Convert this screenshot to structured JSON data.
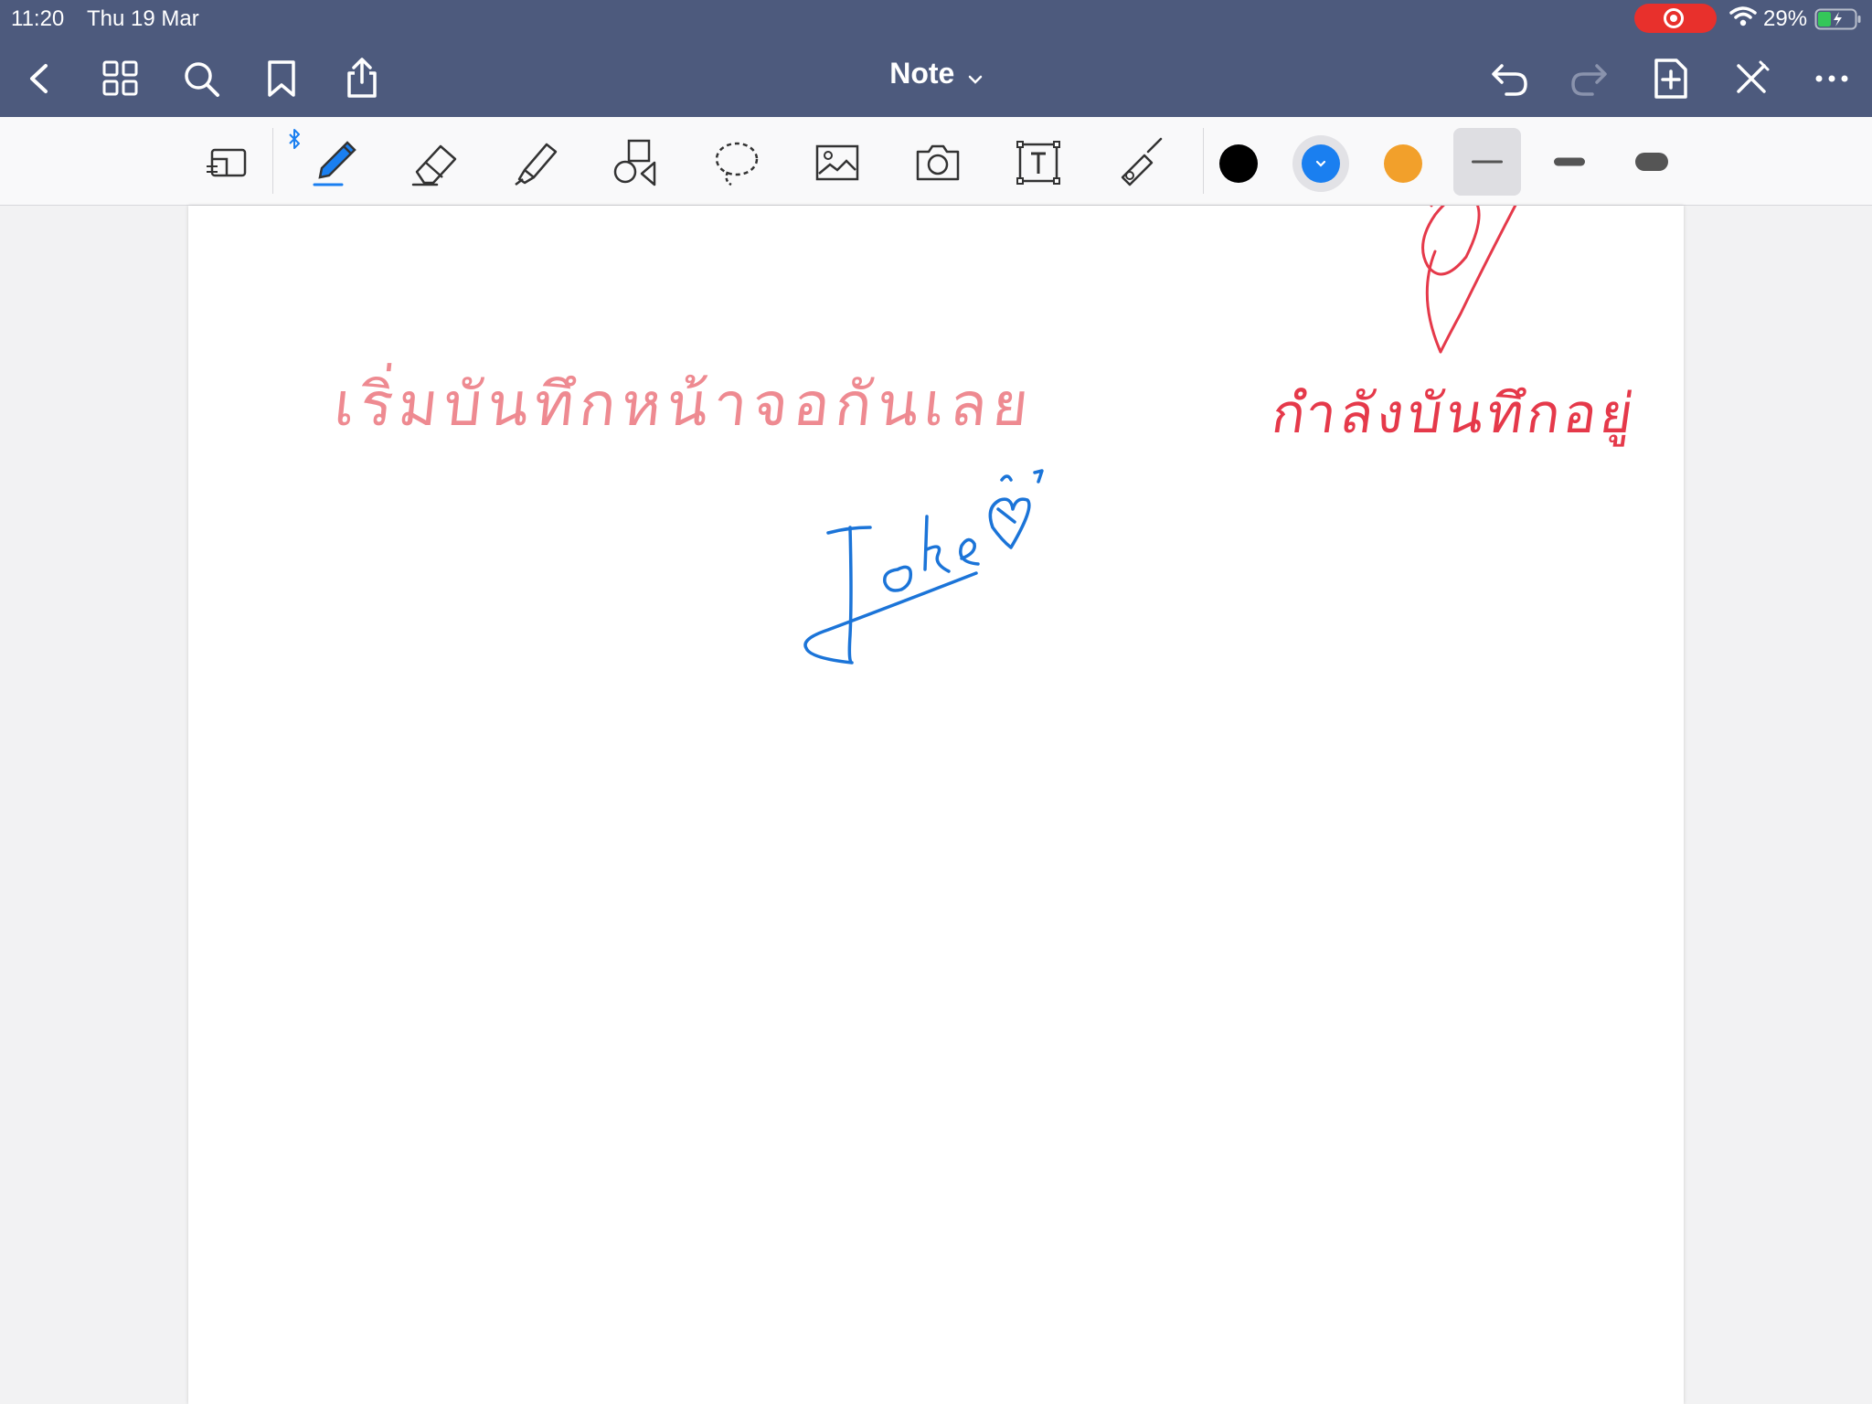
{
  "status_bar": {
    "time": "11:20",
    "date": "Thu 19 Mar",
    "battery_percent": "29%",
    "recording_color": "#e8302c"
  },
  "nav": {
    "title": "Note",
    "icons": [
      "back-chevron-icon",
      "grid-icon",
      "search-icon",
      "bookmark-icon",
      "share-icon",
      "undo-icon",
      "redo-icon",
      "add-page-icon",
      "pencil-off-icon",
      "more-icon"
    ]
  },
  "toolbar": {
    "tools": [
      "shape-ruler-icon",
      "pen-icon",
      "eraser-icon",
      "highlighter-icon",
      "shapes-icon",
      "lasso-icon",
      "image-icon",
      "camera-icon",
      "text-box-icon",
      "laser-pointer-icon"
    ],
    "colors": [
      "#000000",
      "#1a7ff0",
      "#f2a02b"
    ],
    "selected_color": "#1a7ff0",
    "widths": [
      "thin",
      "medium",
      "thick"
    ],
    "selected_width": "thin"
  },
  "canvas": {
    "handwriting": [
      {
        "text": "เริ่มบันทึกหน้าจอกันเลย",
        "color": "#ee8a91"
      },
      {
        "text": "กำลังบันทึกอยู่",
        "color": "#e5394a"
      },
      {
        "text": "Jake",
        "color": "#1b74d8"
      }
    ]
  }
}
